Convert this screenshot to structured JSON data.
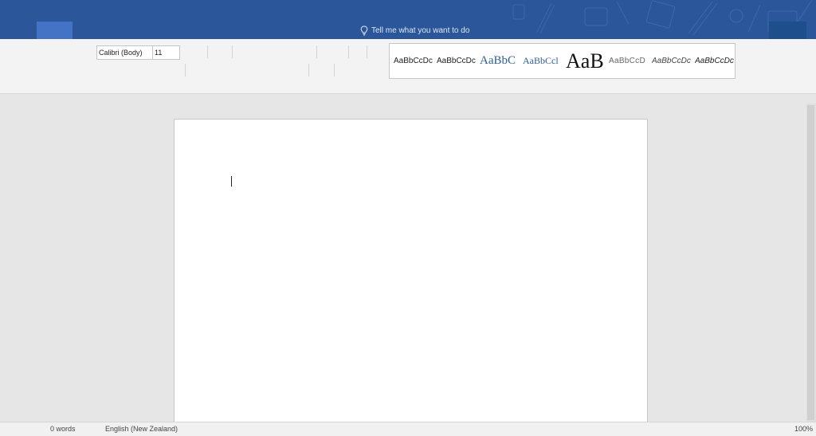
{
  "titlebar": {
    "tell_me_text": "Tell me what you want to do",
    "accent_color": "#2b579a"
  },
  "ribbon": {
    "font_name": "Calibri (Body)",
    "font_size": "11",
    "styles": [
      {
        "preview": "AaBbCcDc",
        "color": "#222222"
      },
      {
        "preview": "AaBbCcDc",
        "color": "#222222"
      },
      {
        "preview": "AaBbC",
        "color": "#2e5e95"
      },
      {
        "preview": "AaBbCcl",
        "color": "#2e5e95"
      },
      {
        "preview": "AaB",
        "color": "#111111"
      },
      {
        "preview": "AaBbCcD",
        "color": "#666666"
      },
      {
        "preview": "AaBbCcDc",
        "color": "#444444"
      },
      {
        "preview": "AaBbCcDc",
        "color": "#222222"
      }
    ]
  },
  "statusbar": {
    "word_count": "0 words",
    "language": "English (New Zealand)",
    "zoom": "100%"
  }
}
